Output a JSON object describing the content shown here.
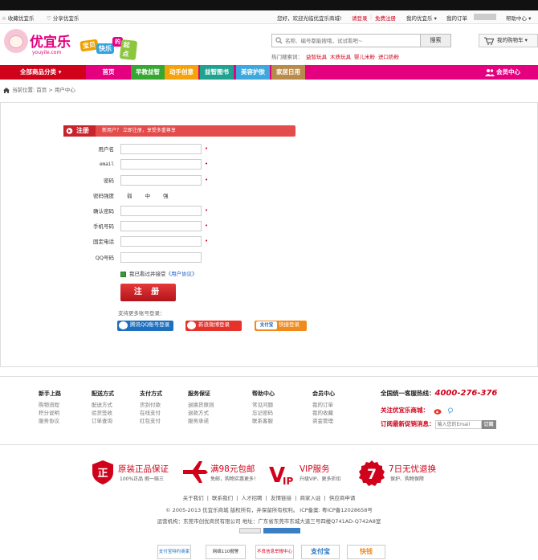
{
  "topbar": {
    "fav": "收藏优宜乐",
    "share": "分享优宜乐",
    "welcome": "您好，欢迎光临优宜乐商城!",
    "login": "请登录",
    "register": "免费注册",
    "my_account": "我的优宜乐",
    "my_orders": "我的订单",
    "help": "帮助中心"
  },
  "logo": {
    "name": "优宜乐",
    "url": "youyile.com"
  },
  "slogan": [
    "宝贝",
    "快乐",
    "的",
    "起点"
  ],
  "search": {
    "placeholder": "名称、编号都能搜哦，试试看吧~",
    "button": "搜索",
    "hot_label": "热门搜索词：",
    "hot_terms": [
      "益智玩具",
      "木质玩具",
      "婴儿米粉",
      "进口奶粉"
    ]
  },
  "cart": {
    "label": "我的购物车"
  },
  "nav": {
    "all_categories": "全部商品分类",
    "items": [
      {
        "label": "首页",
        "color": "#e4007f"
      },
      {
        "label": "早教益智",
        "color": "#36a832"
      },
      {
        "label": "动手创意",
        "color": "#f5a30a"
      },
      {
        "label": "益智图书",
        "color": "#1fa38f"
      },
      {
        "label": "美容护肤",
        "color": "#3ea7de"
      },
      {
        "label": "家居日用",
        "color": "#b98b4a"
      }
    ],
    "member": "会员中心"
  },
  "breadcrumb": {
    "current": "当前位置:",
    "home": "首页",
    "page": "用户中心"
  },
  "register": {
    "title": "注册",
    "subtitle": "新用户？ 立即注册，享受多重尊享",
    "fields": [
      {
        "label": "用户名",
        "required": true
      },
      {
        "label": "email",
        "required": true
      },
      {
        "label": "密码",
        "required": true
      },
      {
        "label": "密码强度",
        "required": false
      },
      {
        "label": "确认密码",
        "required": true
      },
      {
        "label": "手机号码",
        "required": true
      },
      {
        "label": "固定电话",
        "required": true
      },
      {
        "label": "QQ号码",
        "required": false
      }
    ],
    "strength": "弱 中 强",
    "agree_prefix": "我已看过并接受",
    "agree_link": "《用户协议》",
    "submit": "注 册",
    "more_login": "支持更多账号登录：",
    "social": [
      {
        "label": "腾讯QQ账号登录",
        "color": "#1d6fbf"
      },
      {
        "label": "新浪微博登录",
        "color": "#e7322b"
      },
      {
        "label": "快捷登录",
        "color": "#f08a1c",
        "brand": "支付宝"
      }
    ]
  },
  "footer": {
    "columns": [
      {
        "title": "新手上路",
        "items": [
          "购物流程",
          "积分说明",
          "服务协议"
        ]
      },
      {
        "title": "配送方式",
        "items": [
          "配送方式",
          "验货签收",
          "订单查询"
        ]
      },
      {
        "title": "支付方式",
        "items": [
          "货到付款",
          "在线支付",
          "红包支付"
        ]
      },
      {
        "title": "服务保证",
        "items": [
          "退换货原则",
          "退款方式",
          "服务承诺"
        ]
      },
      {
        "title": "帮助中心",
        "items": [
          "常见问题",
          "忘记密码",
          "联系客服"
        ]
      },
      {
        "title": "会员中心",
        "items": [
          "我的订单",
          "我的收藏",
          "资金管理"
        ]
      }
    ],
    "hotline_label": "全国统一客服热线：",
    "hotline": "4000-276-376",
    "follow": "关注优宜乐商城：",
    "subscribe": "订阅最新促销消息：",
    "subscribe_placeholder": "输入您的Email",
    "subscribe_button": "订阅"
  },
  "guarantees": [
    {
      "icon": "正",
      "title": "原装正品保证",
      "sub": "100%正品  假一赔三"
    },
    {
      "icon": "plane",
      "title": "满98元包邮",
      "sub": "免邮，购物实惠更多！"
    },
    {
      "icon": "VIP",
      "title": "VIP服务",
      "sub": "升级VIP、更多折扣"
    },
    {
      "icon": "7",
      "title": "7日无忧退换",
      "sub": "保护、购物保障"
    }
  ],
  "bottom": {
    "links": [
      "关于我们",
      "联系我们",
      "人才招聘",
      "友情链接",
      "商家入驻",
      "供应商申请"
    ],
    "copyright": "© 2005-2013 优宜乐商城 版权所有，并保留所有权利。 ICP备案: 粤ICP备12028658号",
    "operator": "运营机构：东莞市创优商贸有限公司    地址：广东省东莞市东城大道三号四楼Q741AD-Q742A8室",
    "badges": [
      "支付宝特约商家",
      "网络110报警",
      "不良信息举报中心",
      "支付宝",
      "快钱"
    ]
  }
}
